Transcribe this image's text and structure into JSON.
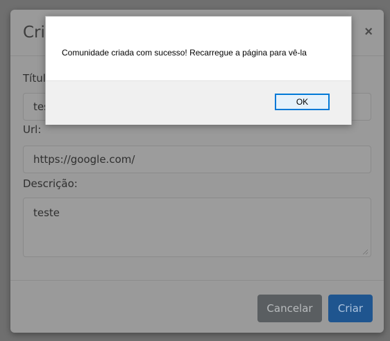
{
  "modal": {
    "title": "Criar",
    "close_symbol": "×",
    "fields": {
      "title_label": "Título:",
      "title_value": "teste",
      "url_label": "Url:",
      "url_value": "https://google.com/",
      "description_label": "Descrição:",
      "description_value": "teste"
    },
    "footer": {
      "cancel_label": "Cancelar",
      "create_label": "Criar"
    }
  },
  "alert": {
    "message": "Comunidade criada com sucesso! Recarregue a página para vê-la",
    "ok_label": "OK"
  },
  "colors": {
    "alert_button_border": "#0078d7",
    "create_button": "#1f558f",
    "cancel_button": "#5a5e61"
  },
  "icons": {
    "close": "close-icon",
    "textarea_resize": "resize-grip-icon"
  }
}
